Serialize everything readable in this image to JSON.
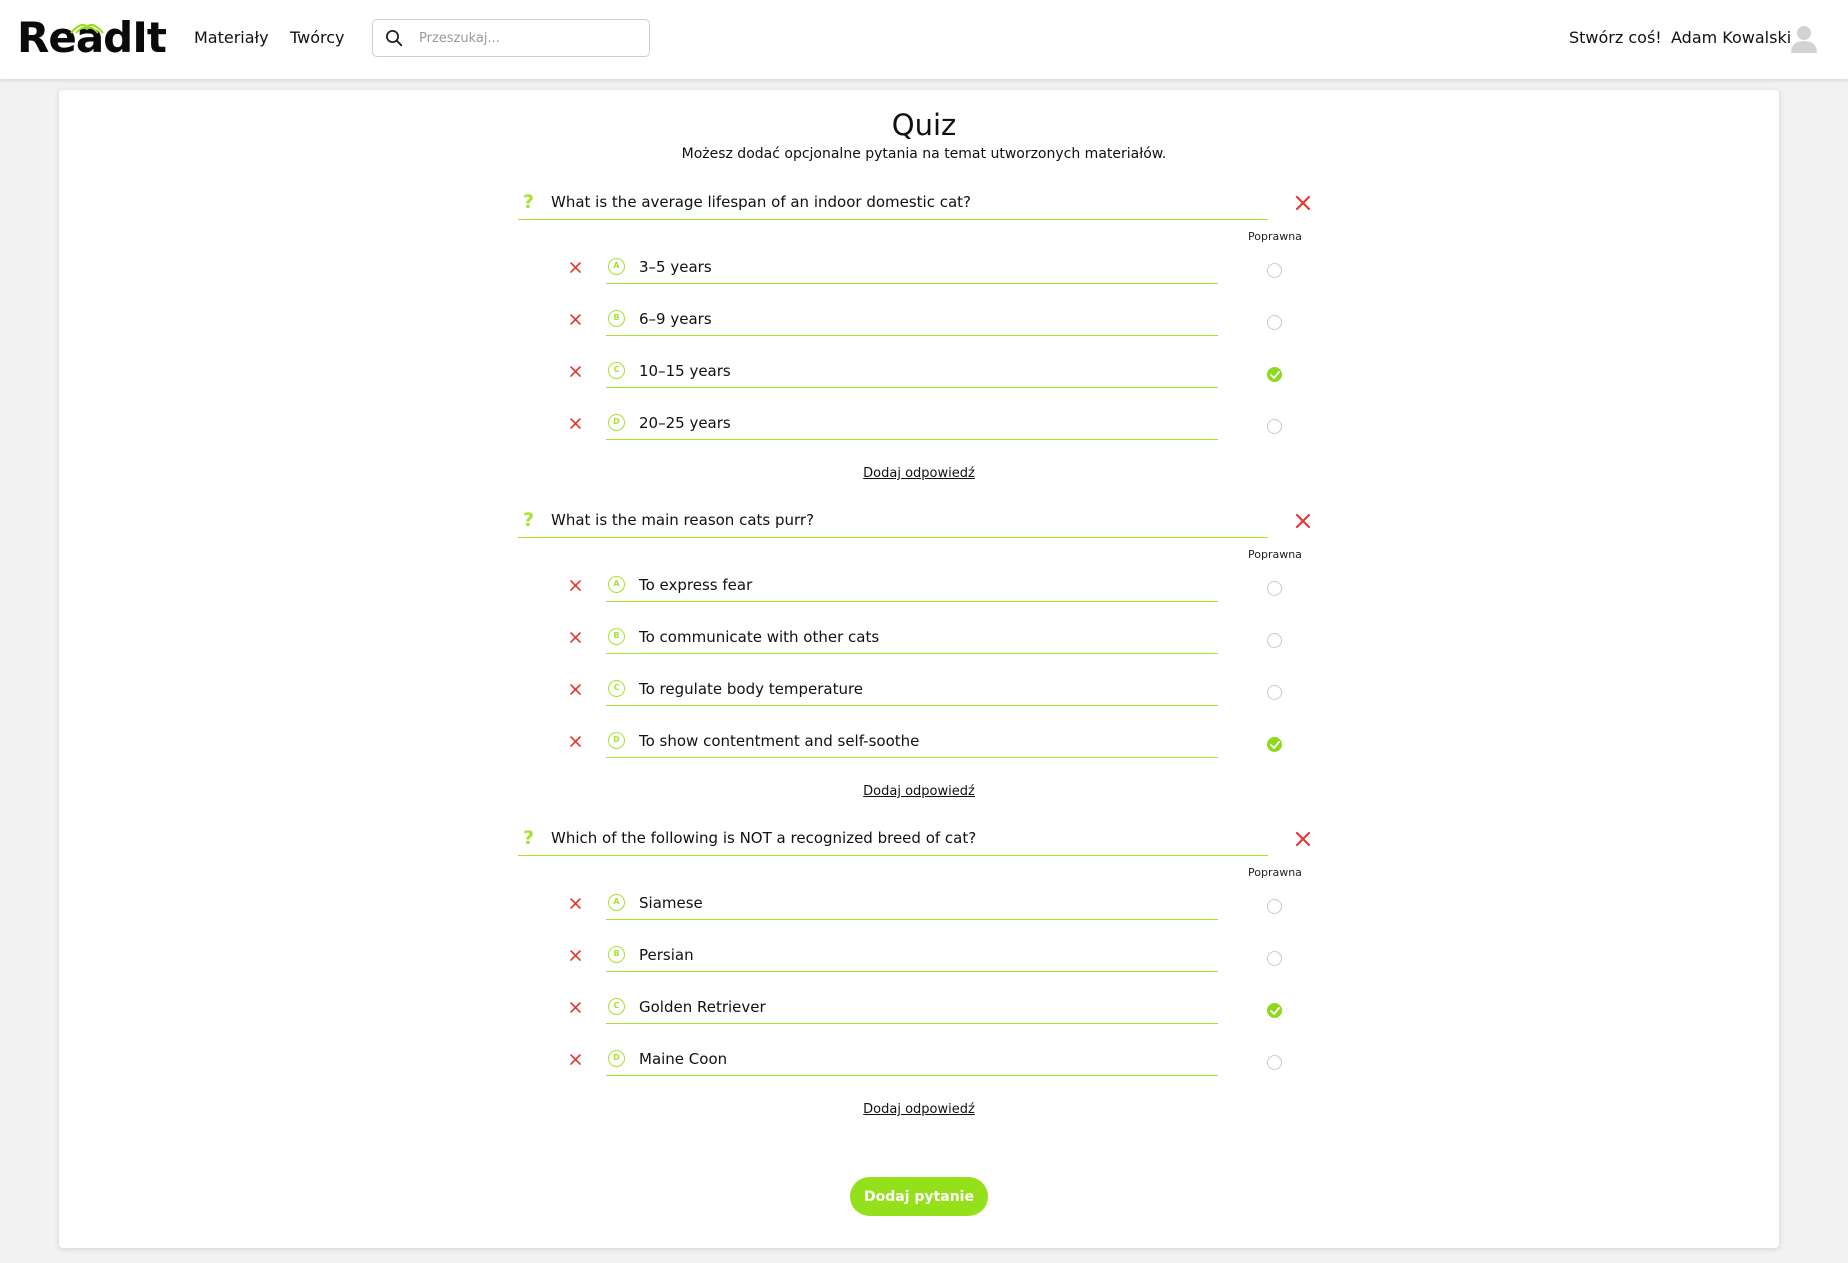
{
  "app": {
    "logo": "ReadIt"
  },
  "nav": {
    "materials": "Materiały",
    "creators": "Twórcy",
    "search_placeholder": "Przeszukaj...",
    "create": "Stwórz coś!",
    "user_name": "Adam Kowalski"
  },
  "page": {
    "title": "Quiz",
    "subtitle": "Możesz dodać opcjonalne pytania na temat utworzonych materiałów.",
    "correct_label": "Poprawna",
    "add_answer": "Dodaj odpowiedź",
    "add_question": "Dodaj pytanie"
  },
  "colors": {
    "accent": "#94e01b",
    "delete": "#e53935"
  },
  "icons": {
    "question": "question-mark-icon",
    "delete": "close-icon",
    "badge": "letter-badge-icon",
    "check": "check-icon",
    "search": "search-icon",
    "avatar": "user-avatar-icon"
  },
  "questions": [
    {
      "text": "What is the average lifespan of an indoor domestic cat?",
      "answers": [
        {
          "letter": "A",
          "text": "3–5 years",
          "correct": false
        },
        {
          "letter": "B",
          "text": "6–9 years",
          "correct": false
        },
        {
          "letter": "C",
          "text": "10–15 years",
          "correct": true
        },
        {
          "letter": "D",
          "text": "20–25 years",
          "correct": false
        }
      ]
    },
    {
      "text": "What is the main reason cats purr?",
      "answers": [
        {
          "letter": "A",
          "text": "To express fear",
          "correct": false
        },
        {
          "letter": "B",
          "text": " To communicate with other cats",
          "correct": false
        },
        {
          "letter": "C",
          "text": "To regulate body temperature",
          "correct": false
        },
        {
          "letter": "D",
          "text": "To show contentment and self-soothe",
          "correct": true
        }
      ]
    },
    {
      "text": "Which of the following is NOT a recognized breed of cat?",
      "answers": [
        {
          "letter": "A",
          "text": "Siamese",
          "correct": false
        },
        {
          "letter": "B",
          "text": "Persian",
          "correct": false
        },
        {
          "letter": "C",
          "text": "Golden Retriever",
          "correct": true
        },
        {
          "letter": "D",
          "text": "Maine Coon",
          "correct": false
        }
      ]
    }
  ]
}
